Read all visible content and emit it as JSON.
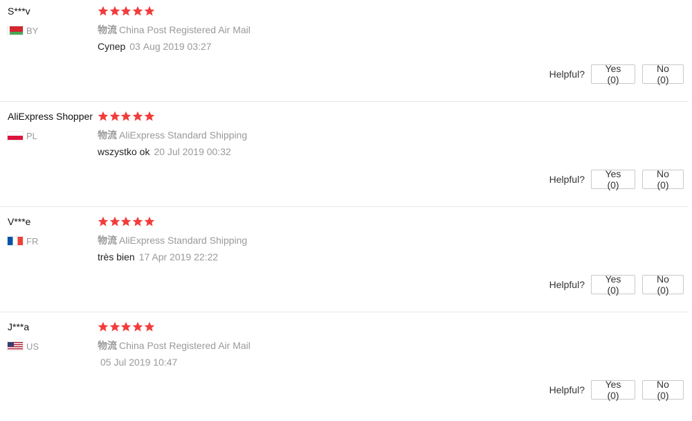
{
  "star_color": "#f23c3c",
  "reviews": [
    {
      "user": "S***v",
      "country": "BY",
      "flag": "flag-by",
      "rating": 5,
      "shipping_label": "物流",
      "shipping": "China Post Registered Air Mail",
      "text": "Супер",
      "date": "03 Aug 2019 03:27",
      "helpful_label": "Helpful?",
      "yes_label": "Yes (0)",
      "no_label": "No (0)"
    },
    {
      "user": "AliExpress Shopper",
      "country": "PL",
      "flag": "flag-pl",
      "rating": 5,
      "shipping_label": "物流",
      "shipping": "AliExpress Standard Shipping",
      "text": "wszystko ok",
      "date": "20 Jul 2019 00:32",
      "helpful_label": "Helpful?",
      "yes_label": "Yes (0)",
      "no_label": "No (0)"
    },
    {
      "user": "V***e",
      "country": "FR",
      "flag": "flag-fr",
      "rating": 5,
      "shipping_label": "物流",
      "shipping": "AliExpress Standard Shipping",
      "text": "très bien",
      "date": "17 Apr 2019 22:22",
      "helpful_label": "Helpful?",
      "yes_label": "Yes (0)",
      "no_label": "No (0)"
    },
    {
      "user": "J***a",
      "country": "US",
      "flag": "flag-us",
      "rating": 5,
      "shipping_label": "物流",
      "shipping": "China Post Registered Air Mail",
      "text": "",
      "date": "05 Jul 2019 10:47",
      "helpful_label": "Helpful?",
      "yes_label": "Yes (0)",
      "no_label": "No (0)"
    }
  ]
}
